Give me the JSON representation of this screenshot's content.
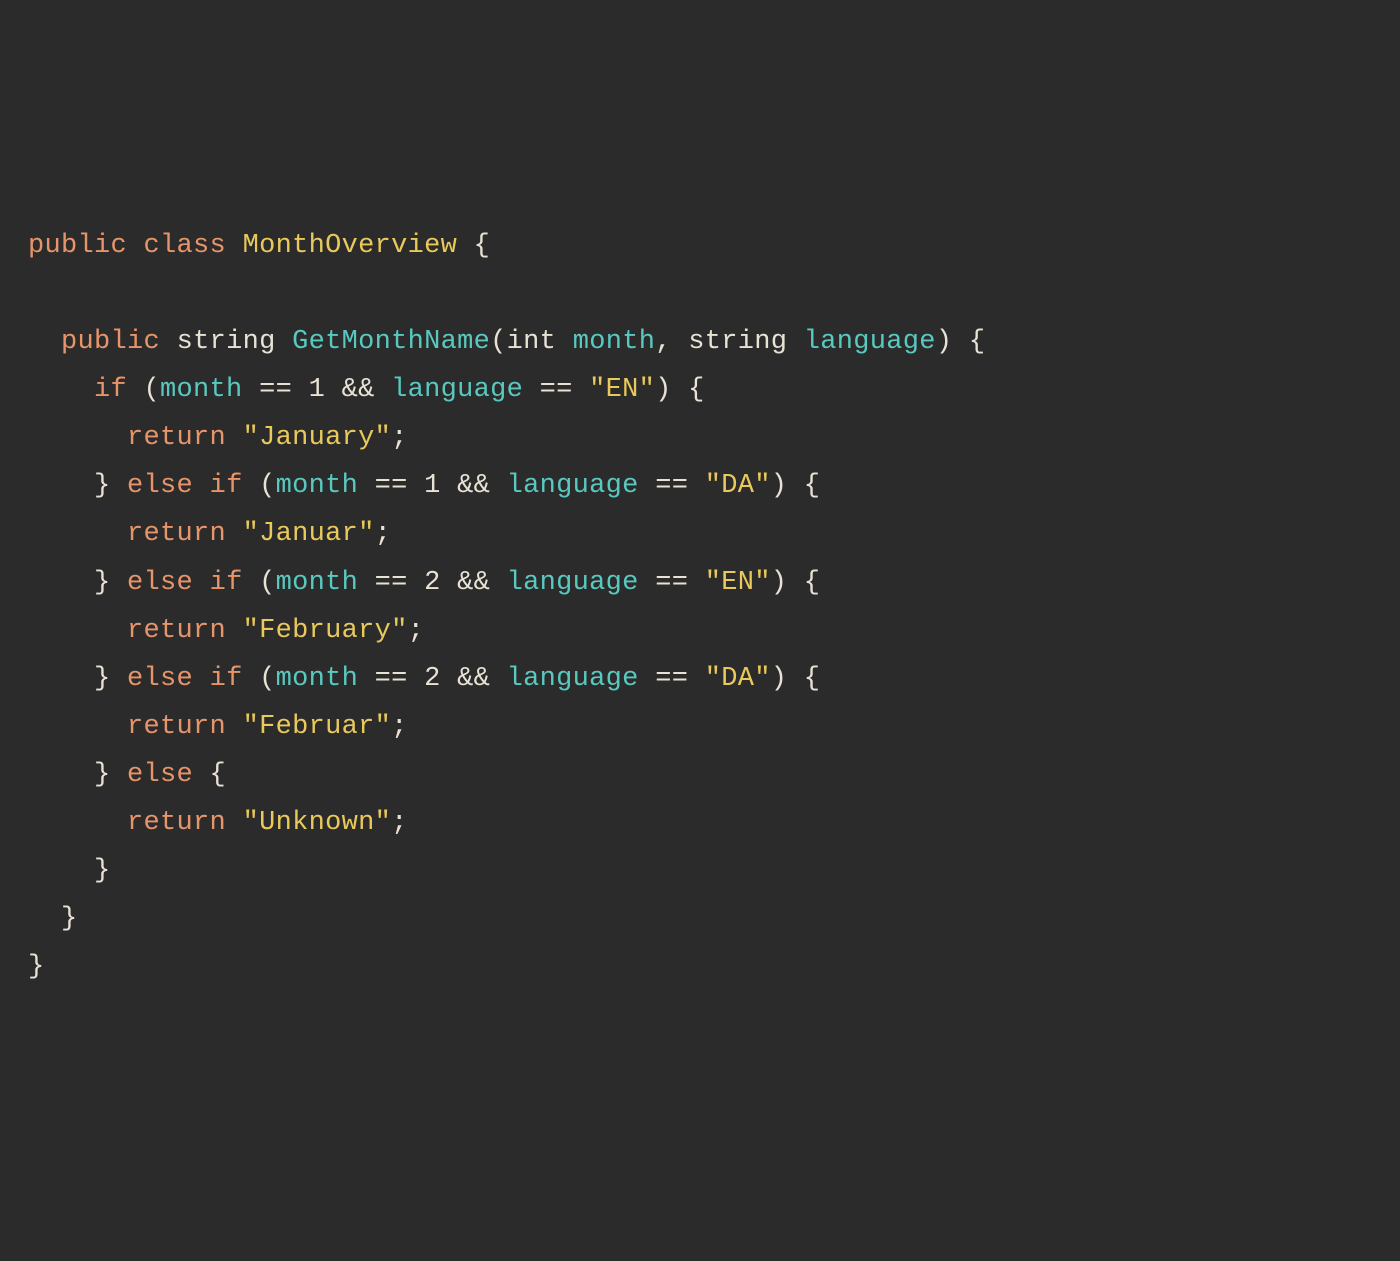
{
  "code": {
    "kw_public_1": "public",
    "kw_class": "class",
    "classname": "MonthOverview",
    "brace_open_1": " {",
    "kw_public_2": "public",
    "type_string_1": "string",
    "method_name": "GetMonthName",
    "paren_open_1": "(",
    "type_int": "int",
    "param_month": "month",
    "comma_1": ", ",
    "type_string_2": "string",
    "param_language": "language",
    "paren_close_sig": ") {",
    "kw_if": "if",
    "paren_open_2": " (",
    "var_month_1": "month",
    "eq_1": " == ",
    "num_1_a": "1",
    "and_1": " && ",
    "var_lang_1": "language",
    "eq_2": " == ",
    "str_en_1": "\"EN\"",
    "paren_close_2": ") {",
    "kw_return_1": "return",
    "str_january": "\"January\"",
    "semi_1": ";",
    "close_elseif_1a": "} ",
    "kw_else_1": "else",
    "kw_if_2": "if",
    "paren_open_3": " (",
    "var_month_2": "month",
    "eq_3": " == ",
    "num_1_b": "1",
    "and_2": " && ",
    "var_lang_2": "language",
    "eq_4": " == ",
    "str_da_1": "\"DA\"",
    "paren_close_3": ") {",
    "kw_return_2": "return",
    "str_januar": "\"Januar\"",
    "semi_2": ";",
    "close_elseif_2a": "} ",
    "kw_else_2": "else",
    "kw_if_3": "if",
    "paren_open_4": " (",
    "var_month_3": "month",
    "eq_5": " == ",
    "num_2_a": "2",
    "and_3": " && ",
    "var_lang_3": "language",
    "eq_6": " == ",
    "str_en_2": "\"EN\"",
    "paren_close_4": ") {",
    "kw_return_3": "return",
    "str_february": "\"February\"",
    "semi_3": ";",
    "close_elseif_3a": "} ",
    "kw_else_3": "else",
    "kw_if_4": "if",
    "paren_open_5": " (",
    "var_month_4": "month",
    "eq_7": " == ",
    "num_2_b": "2",
    "and_4": " && ",
    "var_lang_4": "language",
    "eq_8": " == ",
    "str_da_2": "\"DA\"",
    "paren_close_5": ") {",
    "kw_return_4": "return",
    "str_februar": "\"Februar\"",
    "semi_4": ";",
    "close_else_a": "} ",
    "kw_else_4": "else",
    "brace_open_else": " {",
    "kw_return_5": "return",
    "str_unknown": "\"Unknown\"",
    "semi_5": ";",
    "close_else_inner": "}",
    "close_method": "}",
    "close_class": "}"
  }
}
